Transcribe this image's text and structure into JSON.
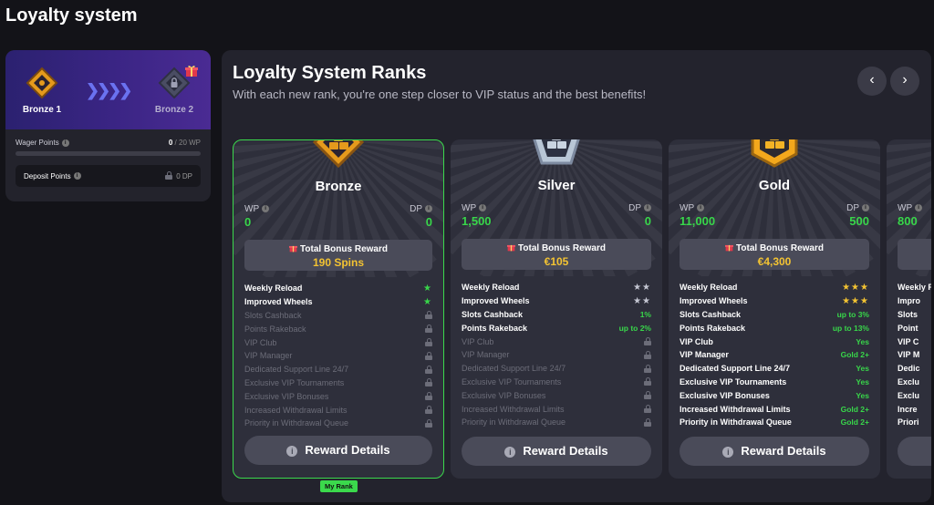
{
  "page": {
    "title": "Loyalty system"
  },
  "progress": {
    "from_rank": "Bronze 1",
    "to_rank": "Bronze 2",
    "wager_label": "Wager Points",
    "wager_current": "0",
    "wager_total": "/ 20 WP",
    "wager_fraction": 0,
    "deposit_label": "Deposit Points",
    "deposit_value": "0 DP"
  },
  "main": {
    "title": "Loyalty System Ranks",
    "subtitle": "With each new rank, you're one step closer to VIP status and the best benefits!",
    "prev_icon": "chevron-left-icon",
    "next_icon": "chevron-right-icon",
    "my_rank_label": "My Rank",
    "cards": [
      {
        "name": "Bronze",
        "wp_label": "WP",
        "wp_value": "0",
        "dp_label": "DP",
        "dp_value": "0",
        "bonus_label": "Total Bonus Reward",
        "bonus_value": "190 Spins",
        "button": "Reward Details",
        "features": [
          {
            "name": "Weekly Reload",
            "state": "on",
            "stars": 1
          },
          {
            "name": "Improved Wheels",
            "state": "on",
            "stars": 1
          },
          {
            "name": "Slots Cashback",
            "state": "off"
          },
          {
            "name": "Points Rakeback",
            "state": "off"
          },
          {
            "name": "VIP Club",
            "state": "off"
          },
          {
            "name": "VIP Manager",
            "state": "off"
          },
          {
            "name": "Dedicated Support Line 24/7",
            "state": "off"
          },
          {
            "name": "Exclusive VIP Tournaments",
            "state": "off"
          },
          {
            "name": "Exclusive VIP Bonuses",
            "state": "off"
          },
          {
            "name": "Increased Withdrawal Limits",
            "state": "off"
          },
          {
            "name": "Priority in Withdrawal Queue",
            "state": "off"
          }
        ]
      },
      {
        "name": "Silver",
        "wp_label": "WP",
        "wp_value": "1,500",
        "dp_label": "DP",
        "dp_value": "0",
        "bonus_label": "Total Bonus Reward",
        "bonus_value": "€105",
        "button": "Reward Details",
        "features": [
          {
            "name": "Weekly Reload",
            "state": "on",
            "stars": 2
          },
          {
            "name": "Improved Wheels",
            "state": "on",
            "stars": 2
          },
          {
            "name": "Slots Cashback",
            "state": "on",
            "value": "1%"
          },
          {
            "name": "Points Rakeback",
            "state": "on",
            "value": "up to 2%"
          },
          {
            "name": "VIP Club",
            "state": "off"
          },
          {
            "name": "VIP Manager",
            "state": "off"
          },
          {
            "name": "Dedicated Support Line 24/7",
            "state": "off"
          },
          {
            "name": "Exclusive VIP Tournaments",
            "state": "off"
          },
          {
            "name": "Exclusive VIP Bonuses",
            "state": "off"
          },
          {
            "name": "Increased Withdrawal Limits",
            "state": "off"
          },
          {
            "name": "Priority in Withdrawal Queue",
            "state": "off"
          }
        ]
      },
      {
        "name": "Gold",
        "wp_label": "WP",
        "wp_value": "11,000",
        "dp_label": "DP",
        "dp_value": "500",
        "bonus_label": "Total Bonus Reward",
        "bonus_value": "€4,300",
        "button": "Reward Details",
        "features": [
          {
            "name": "Weekly Reload",
            "state": "on",
            "stars": 3
          },
          {
            "name": "Improved Wheels",
            "state": "on",
            "stars": 3
          },
          {
            "name": "Slots Cashback",
            "state": "on",
            "value": "up to 3%"
          },
          {
            "name": "Points Rakeback",
            "state": "on",
            "value": "up to 13%"
          },
          {
            "name": "VIP Club",
            "state": "on",
            "value": "Yes"
          },
          {
            "name": "VIP Manager",
            "state": "on",
            "value": "Gold 2+"
          },
          {
            "name": "Dedicated Support Line 24/7",
            "state": "on",
            "value": "Yes"
          },
          {
            "name": "Exclusive VIP Tournaments",
            "state": "on",
            "value": "Yes"
          },
          {
            "name": "Exclusive VIP Bonuses",
            "state": "on",
            "value": "Yes"
          },
          {
            "name": "Increased Withdrawal Limits",
            "state": "on",
            "value": "Gold 2+"
          },
          {
            "name": "Priority in Withdrawal Queue",
            "state": "on",
            "value": "Gold 2+"
          }
        ]
      },
      {
        "name": "",
        "wp_label": "WP",
        "wp_value": "800",
        "features": [
          {
            "name": "Weekly Reload",
            "state": "on"
          },
          {
            "name": "Impro",
            "state": "on"
          },
          {
            "name": "Slots",
            "state": "on"
          },
          {
            "name": "Point",
            "state": "on"
          },
          {
            "name": "VIP C",
            "state": "on"
          },
          {
            "name": "VIP M",
            "state": "on"
          },
          {
            "name": "Dedic",
            "state": "on"
          },
          {
            "name": "Exclu",
            "state": "on"
          },
          {
            "name": "Exclu",
            "state": "on"
          },
          {
            "name": "Incre",
            "state": "on"
          },
          {
            "name": "Priori",
            "state": "on"
          }
        ]
      }
    ]
  },
  "colors": {
    "accent_green": "#38d64a",
    "gold": "#f3c332",
    "bronze": "#e59a1c",
    "silver": "#b8c6d6"
  }
}
